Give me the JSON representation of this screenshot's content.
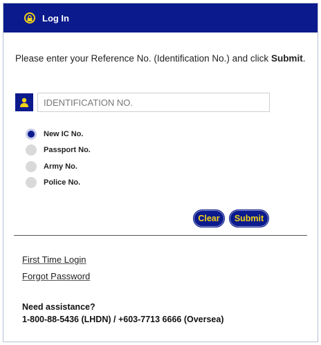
{
  "header": {
    "title": "Log In",
    "icon": "lock-icon"
  },
  "intro": {
    "text": "Please enter your Reference No. (Identification No.) and click ",
    "emphasis": "Submit",
    "end": "."
  },
  "id_field": {
    "placeholder": "IDENTIFICATION NO.",
    "value": "",
    "icon": "user-icon"
  },
  "id_types": [
    {
      "label": "New IC No.",
      "checked": true
    },
    {
      "label": "Passport No.",
      "checked": false
    },
    {
      "label": "Army No.",
      "checked": false
    },
    {
      "label": "Police No.",
      "checked": false
    }
  ],
  "buttons": {
    "clear": "Clear",
    "submit": "Submit"
  },
  "links": {
    "first_time": "First Time Login",
    "forgot": "Forgot Password"
  },
  "assistance": {
    "heading": "Need assistance?",
    "phones": "1-800-88-5436 (LHDN) / +603-7713 6666 (Oversea)"
  },
  "colors": {
    "primary": "#0b1a8c",
    "accent": "#f2d21a"
  }
}
